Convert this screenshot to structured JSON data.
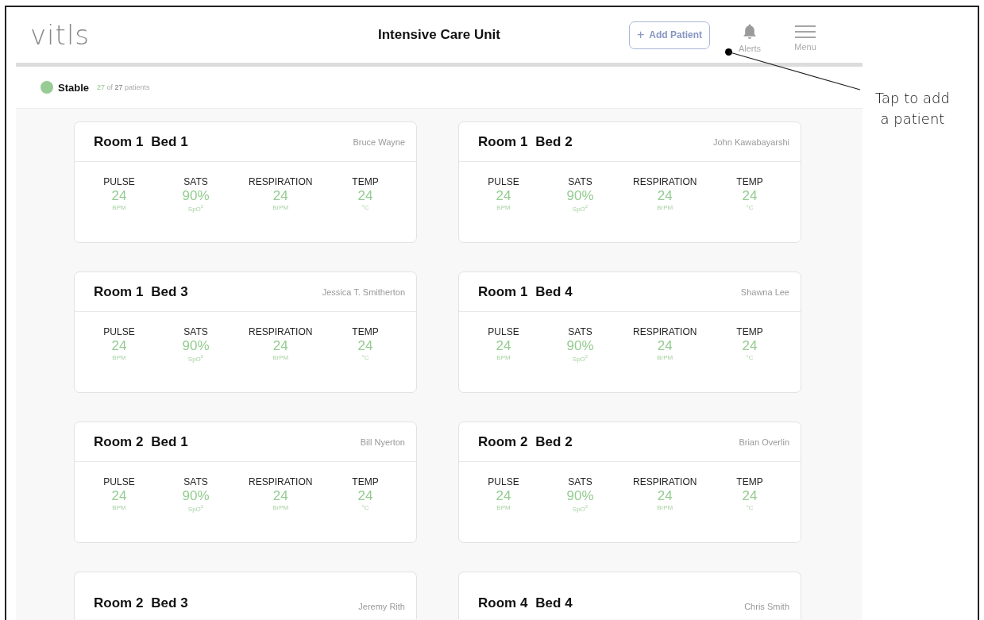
{
  "header": {
    "logo": "vitls",
    "title": "Intensive Care Unit",
    "add_button": {
      "icon": "+",
      "label": "Add Patient"
    },
    "alerts": "Alerts",
    "menu": "Menu"
  },
  "status": {
    "label": "Stable",
    "count": "27",
    "of_text": "of",
    "total": "27",
    "suffix": "patients"
  },
  "annotation": {
    "text": "Tap to add a patient"
  },
  "cards": [
    {
      "room": "Room 1",
      "bed": "Bed 1",
      "patient": "Bruce Wayne",
      "metrics": [
        {
          "label": "PULSE",
          "value": "24",
          "unit": "BPM"
        },
        {
          "label": "SATS",
          "value": "90%",
          "unit": "SpO$^{2}$"
        },
        {
          "label": "RESPIRATION",
          "value": "24",
          "unit": "BrPM"
        },
        {
          "label": "TEMP",
          "value": "24",
          "unit": "°C"
        }
      ]
    },
    {
      "room": "Room 1",
      "bed": "Bed 2",
      "patient": "John Kawabayarshi",
      "metrics": [
        {
          "label": "PULSE",
          "value": "24",
          "unit": "BPM"
        },
        {
          "label": "SATS",
          "value": "90%",
          "unit": "SpO$^{2}$"
        },
        {
          "label": "RESPIRATION",
          "value": "24",
          "unit": "BrPM"
        },
        {
          "label": "TEMP",
          "value": "24",
          "unit": "°C"
        }
      ]
    },
    {
      "room": "Room 1",
      "bed": "Bed 3",
      "patient": "Jessica T. Smitherton",
      "metrics": [
        {
          "label": "PULSE",
          "value": "24",
          "unit": "BPM"
        },
        {
          "label": "SATS",
          "value": "90%",
          "unit": "SpO$^{2}$"
        },
        {
          "label": "RESPIRATION",
          "value": "24",
          "unit": "BrPM"
        },
        {
          "label": "TEMP",
          "value": "24",
          "unit": "°C"
        }
      ]
    },
    {
      "room": "Room 1",
      "bed": "Bed 4",
      "patient": "Shawna Lee",
      "metrics": [
        {
          "label": "PULSE",
          "value": "24",
          "unit": "BPM"
        },
        {
          "label": "SATS",
          "value": "90%",
          "unit": "SpO$^{2}$"
        },
        {
          "label": "RESPIRATION",
          "value": "24",
          "unit": "BrPM"
        },
        {
          "label": "TEMP",
          "value": "24",
          "unit": "°C"
        }
      ]
    },
    {
      "room": "Room 2",
      "bed": "Bed 1",
      "patient": "Bill Nyerton",
      "metrics": [
        {
          "label": "PULSE",
          "value": "24",
          "unit": "BPM"
        },
        {
          "label": "SATS",
          "value": "90%",
          "unit": "SpO$^{2}$"
        },
        {
          "label": "RESPIRATION",
          "value": "24",
          "unit": "BrPM"
        },
        {
          "label": "TEMP",
          "value": "24",
          "unit": "°C"
        }
      ]
    },
    {
      "room": "Room 2",
      "bed": "Bed 2",
      "patient": "Brian Overlin",
      "metrics": [
        {
          "label": "PULSE",
          "value": "24",
          "unit": "BPM"
        },
        {
          "label": "SATS",
          "value": "90%",
          "unit": "SpO$^{2}$"
        },
        {
          "label": "RESPIRATION",
          "value": "24",
          "unit": "BrPM"
        },
        {
          "label": "TEMP",
          "value": "24",
          "unit": "°C"
        }
      ]
    },
    {
      "room": "Room 2",
      "bed": "Bed 3",
      "patient": "Jeremy Rith"
    },
    {
      "room": "Room 4",
      "bed": "Bed 4",
      "patient": "Chris Smith"
    }
  ]
}
